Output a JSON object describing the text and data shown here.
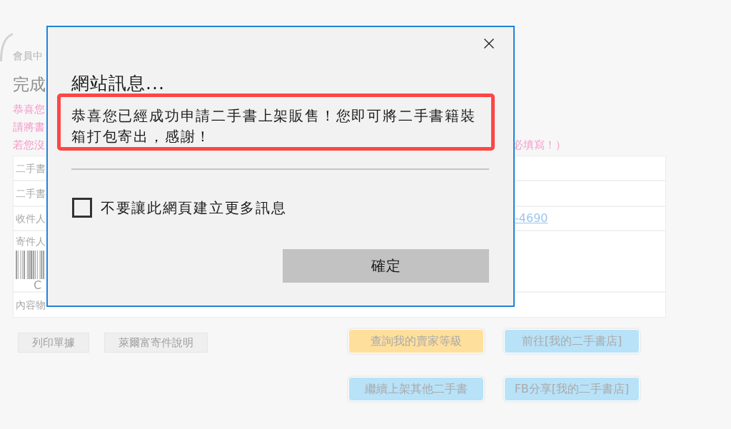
{
  "page": {
    "breadcrumb": "會員中",
    "heading": "完成",
    "notice_lines": [
      {
        "left": "恭喜您"
      },
      {
        "left": "請將書"
      },
      {
        "left": "若您沒",
        "right": "必填寫！）"
      }
    ],
    "table_rows": [
      {
        "kind": "plain",
        "label": "二手書"
      },
      {
        "kind": "plain",
        "label": "二手書"
      },
      {
        "kind": "link",
        "label": "收件人",
        "value": "-4690"
      },
      {
        "kind": "barcode",
        "label": "寄件人",
        "code": "C"
      },
      {
        "kind": "plain",
        "label": "內容物"
      }
    ],
    "buttons": [
      "列印單據",
      "萊爾富寄件說明"
    ],
    "action_buttons": [
      {
        "label": "查詢我的賣家等級",
        "color": "#ffdf9c"
      },
      {
        "label": "前往[我的二手書店]",
        "color": "#b8e2f8"
      },
      {
        "label": "繼續上架其他二手書",
        "color": "#b8e2f8"
      },
      {
        "label": "FB分享[我的二手書店]",
        "color": "#b8e2f8"
      }
    ]
  },
  "dialog": {
    "title": "網站訊息...",
    "message": "恭喜您已經成功申請二手書上架販售！您即可將二手書籍裝箱打包寄出，感謝！",
    "highlighted": true,
    "checkbox": {
      "label": "不要讓此網頁建立更多訊息",
      "checked": false
    },
    "ok_button": "確定"
  }
}
